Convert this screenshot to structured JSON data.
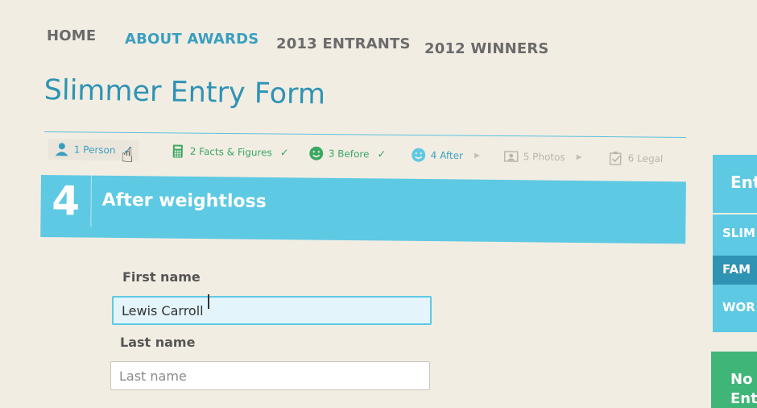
{
  "nav": [
    {
      "label": "HOME"
    },
    {
      "label": "ABOUT AWARDS",
      "active": true
    },
    {
      "label": "2013 ENTRANTS"
    },
    {
      "label": "2012 WINNERS"
    }
  ],
  "page_title": "Slimmer Entry Form",
  "steps": [
    {
      "label": "1 Person",
      "icon": "person-icon",
      "status": "done"
    },
    {
      "label": "2 Facts & Figures",
      "icon": "calculator-icon",
      "status": "done"
    },
    {
      "label": "3 Before",
      "icon": "smiley-icon",
      "status": "done"
    },
    {
      "label": "4 After",
      "icon": "smiley-icon",
      "status": "current"
    },
    {
      "label": "5 Photos",
      "icon": "photo-icon",
      "status": "todo"
    },
    {
      "label": "6 Legal",
      "icon": "checklist-icon",
      "status": "todo"
    }
  ],
  "banner": {
    "number": "4",
    "title": "After weightloss"
  },
  "form": {
    "first_name": {
      "label": "First name",
      "value": "Lewis Carroll"
    },
    "last_name": {
      "label": "Last name",
      "placeholder": "Last name"
    }
  },
  "sidebar": {
    "heading": "Ent",
    "items": [
      {
        "label": "SLIM"
      },
      {
        "label": "FAM",
        "active": true
      },
      {
        "label": "WOR"
      }
    ]
  },
  "green_box": {
    "line1": "No",
    "line2": "Ent"
  },
  "colors": {
    "accent": "#5ec9e3",
    "title": "#2f93b4",
    "done": "#3aa862",
    "background": "#f2ede3"
  }
}
